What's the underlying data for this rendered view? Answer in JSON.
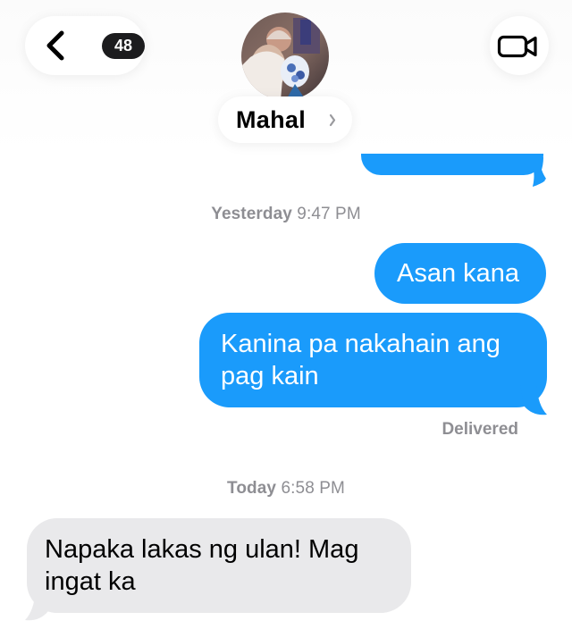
{
  "header": {
    "unread_count": "48",
    "contact_name": "Mahal",
    "back_icon": "chevron-left-icon",
    "video_icon": "video-camera-icon",
    "name_chevron_icon": "chevron-right-icon"
  },
  "colors": {
    "outgoing_bubble": "#1a9bfb",
    "incoming_bubble": "#e9e9eb",
    "meta_text": "#8e8e93"
  },
  "conversation": {
    "timestamp_1": {
      "day": "Yesterday",
      "time": "9:47 PM"
    },
    "outgoing_1": "Asan kana",
    "outgoing_2": "Kanina pa nakahain ang pag kain",
    "delivered_label": "Delivered",
    "timestamp_2": {
      "day": "Today",
      "time": "6:58 PM"
    },
    "incoming_1": "Napaka lakas ng ulan! Mag ingat ka"
  }
}
